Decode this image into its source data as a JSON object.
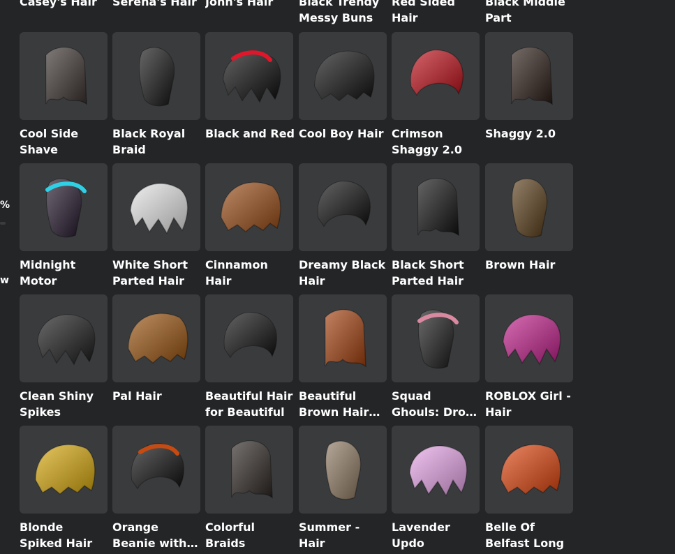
{
  "edge": {
    "percent_fragment": "%",
    "w_fragment": "w"
  },
  "rows": [
    {
      "items": [
        {
          "name": "Casey's Hair",
          "icon": "hair-thumbnail-icon"
        },
        {
          "name": "Serena's Hair",
          "icon": "hair-thumbnail-icon"
        },
        {
          "name": "John's Hair",
          "icon": "hair-thumbnail-icon"
        },
        {
          "name": "Black Trendy Messy Buns",
          "icon": "hair-thumbnail-icon"
        },
        {
          "name": "Red Sided Hair",
          "icon": "hair-thumbnail-icon"
        },
        {
          "name": "Black Middle Part",
          "icon": "hair-thumbnail-icon"
        }
      ]
    },
    {
      "items": [
        {
          "name": "Cool Side Shave",
          "color": "#3b3230"
        },
        {
          "name": "Black Royal Braid",
          "color": "#151515"
        },
        {
          "name": "Black and Red",
          "color": "#0d0d0d",
          "accent": "#e1162a"
        },
        {
          "name": "Cool Boy Hair",
          "color": "#121212"
        },
        {
          "name": "Crimson Shaggy 2.0",
          "color": "#c0111b"
        },
        {
          "name": "Shaggy 2.0",
          "color": "#2b1d17"
        }
      ]
    },
    {
      "items": [
        {
          "name": "Midnight Motor",
          "color": "#24182c",
          "accent": "#2fd0e6"
        },
        {
          "name": "White Short Parted Hair",
          "color": "#e6e6e6"
        },
        {
          "name": "Cinnamon Hair",
          "color": "#9a4c16"
        },
        {
          "name": "Dreamy Black Hair",
          "color": "#111111"
        },
        {
          "name": "Black Short Parted Hair",
          "color": "#121212"
        },
        {
          "name": "Brown Hair",
          "color": "#5a3d1a"
        }
      ]
    },
    {
      "items": [
        {
          "name": "Clean Shiny Spikes",
          "color": "#1b1b1b"
        },
        {
          "name": "Pal Hair",
          "color": "#9a5410"
        },
        {
          "name": "Beautiful Hair for Beautiful",
          "color": "#111111"
        },
        {
          "name": "Beautiful Brown Hair for",
          "color": "#a3410f"
        },
        {
          "name": "Squad Ghouls: Drop Dead",
          "color": "#1c1c1c",
          "accent": "#d98aa0"
        },
        {
          "name": "ROBLOX Girl - Hair",
          "color": "#c21f8b"
        }
      ]
    },
    {
      "items": [
        {
          "name": "Blonde Spiked Hair",
          "color": "#d8a90d"
        },
        {
          "name": "Orange Beanie with Black",
          "color": "#111111",
          "accent": "#c64b12"
        },
        {
          "name": "Colorful Braids",
          "color": "#2e2723"
        },
        {
          "name": "Summer - Hair",
          "color": "#8f7a63"
        },
        {
          "name": "Lavender Updo",
          "color": "#e9a6e9"
        },
        {
          "name": "Belle Of Belfast Long",
          "color": "#e0450f"
        }
      ]
    }
  ]
}
